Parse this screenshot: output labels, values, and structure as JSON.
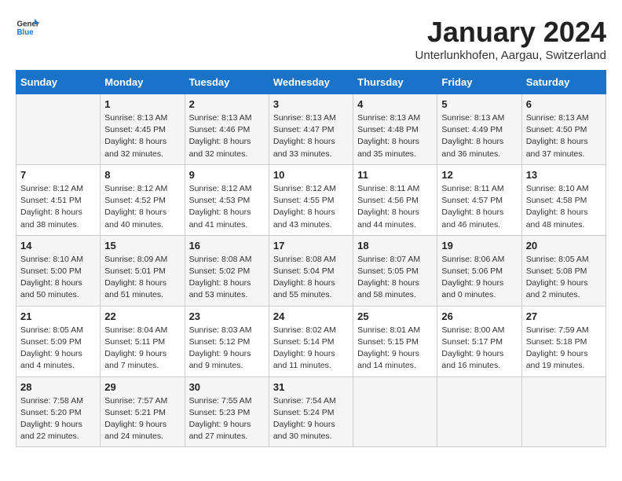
{
  "logo": {
    "line1": "General",
    "line2": "Blue"
  },
  "title": "January 2024",
  "subtitle": "Unterlunkhofen, Aargau, Switzerland",
  "days_of_week": [
    "Sunday",
    "Monday",
    "Tuesday",
    "Wednesday",
    "Thursday",
    "Friday",
    "Saturday"
  ],
  "weeks": [
    [
      {
        "num": "",
        "info": ""
      },
      {
        "num": "1",
        "info": "Sunrise: 8:13 AM\nSunset: 4:45 PM\nDaylight: 8 hours\nand 32 minutes."
      },
      {
        "num": "2",
        "info": "Sunrise: 8:13 AM\nSunset: 4:46 PM\nDaylight: 8 hours\nand 32 minutes."
      },
      {
        "num": "3",
        "info": "Sunrise: 8:13 AM\nSunset: 4:47 PM\nDaylight: 8 hours\nand 33 minutes."
      },
      {
        "num": "4",
        "info": "Sunrise: 8:13 AM\nSunset: 4:48 PM\nDaylight: 8 hours\nand 35 minutes."
      },
      {
        "num": "5",
        "info": "Sunrise: 8:13 AM\nSunset: 4:49 PM\nDaylight: 8 hours\nand 36 minutes."
      },
      {
        "num": "6",
        "info": "Sunrise: 8:13 AM\nSunset: 4:50 PM\nDaylight: 8 hours\nand 37 minutes."
      }
    ],
    [
      {
        "num": "7",
        "info": "Sunrise: 8:12 AM\nSunset: 4:51 PM\nDaylight: 8 hours\nand 38 minutes."
      },
      {
        "num": "8",
        "info": "Sunrise: 8:12 AM\nSunset: 4:52 PM\nDaylight: 8 hours\nand 40 minutes."
      },
      {
        "num": "9",
        "info": "Sunrise: 8:12 AM\nSunset: 4:53 PM\nDaylight: 8 hours\nand 41 minutes."
      },
      {
        "num": "10",
        "info": "Sunrise: 8:12 AM\nSunset: 4:55 PM\nDaylight: 8 hours\nand 43 minutes."
      },
      {
        "num": "11",
        "info": "Sunrise: 8:11 AM\nSunset: 4:56 PM\nDaylight: 8 hours\nand 44 minutes."
      },
      {
        "num": "12",
        "info": "Sunrise: 8:11 AM\nSunset: 4:57 PM\nDaylight: 8 hours\nand 46 minutes."
      },
      {
        "num": "13",
        "info": "Sunrise: 8:10 AM\nSunset: 4:58 PM\nDaylight: 8 hours\nand 48 minutes."
      }
    ],
    [
      {
        "num": "14",
        "info": "Sunrise: 8:10 AM\nSunset: 5:00 PM\nDaylight: 8 hours\nand 50 minutes."
      },
      {
        "num": "15",
        "info": "Sunrise: 8:09 AM\nSunset: 5:01 PM\nDaylight: 8 hours\nand 51 minutes."
      },
      {
        "num": "16",
        "info": "Sunrise: 8:08 AM\nSunset: 5:02 PM\nDaylight: 8 hours\nand 53 minutes."
      },
      {
        "num": "17",
        "info": "Sunrise: 8:08 AM\nSunset: 5:04 PM\nDaylight: 8 hours\nand 55 minutes."
      },
      {
        "num": "18",
        "info": "Sunrise: 8:07 AM\nSunset: 5:05 PM\nDaylight: 8 hours\nand 58 minutes."
      },
      {
        "num": "19",
        "info": "Sunrise: 8:06 AM\nSunset: 5:06 PM\nDaylight: 9 hours\nand 0 minutes."
      },
      {
        "num": "20",
        "info": "Sunrise: 8:05 AM\nSunset: 5:08 PM\nDaylight: 9 hours\nand 2 minutes."
      }
    ],
    [
      {
        "num": "21",
        "info": "Sunrise: 8:05 AM\nSunset: 5:09 PM\nDaylight: 9 hours\nand 4 minutes."
      },
      {
        "num": "22",
        "info": "Sunrise: 8:04 AM\nSunset: 5:11 PM\nDaylight: 9 hours\nand 7 minutes."
      },
      {
        "num": "23",
        "info": "Sunrise: 8:03 AM\nSunset: 5:12 PM\nDaylight: 9 hours\nand 9 minutes."
      },
      {
        "num": "24",
        "info": "Sunrise: 8:02 AM\nSunset: 5:14 PM\nDaylight: 9 hours\nand 11 minutes."
      },
      {
        "num": "25",
        "info": "Sunrise: 8:01 AM\nSunset: 5:15 PM\nDaylight: 9 hours\nand 14 minutes."
      },
      {
        "num": "26",
        "info": "Sunrise: 8:00 AM\nSunset: 5:17 PM\nDaylight: 9 hours\nand 16 minutes."
      },
      {
        "num": "27",
        "info": "Sunrise: 7:59 AM\nSunset: 5:18 PM\nDaylight: 9 hours\nand 19 minutes."
      }
    ],
    [
      {
        "num": "28",
        "info": "Sunrise: 7:58 AM\nSunset: 5:20 PM\nDaylight: 9 hours\nand 22 minutes."
      },
      {
        "num": "29",
        "info": "Sunrise: 7:57 AM\nSunset: 5:21 PM\nDaylight: 9 hours\nand 24 minutes."
      },
      {
        "num": "30",
        "info": "Sunrise: 7:55 AM\nSunset: 5:23 PM\nDaylight: 9 hours\nand 27 minutes."
      },
      {
        "num": "31",
        "info": "Sunrise: 7:54 AM\nSunset: 5:24 PM\nDaylight: 9 hours\nand 30 minutes."
      },
      {
        "num": "",
        "info": ""
      },
      {
        "num": "",
        "info": ""
      },
      {
        "num": "",
        "info": ""
      }
    ]
  ]
}
